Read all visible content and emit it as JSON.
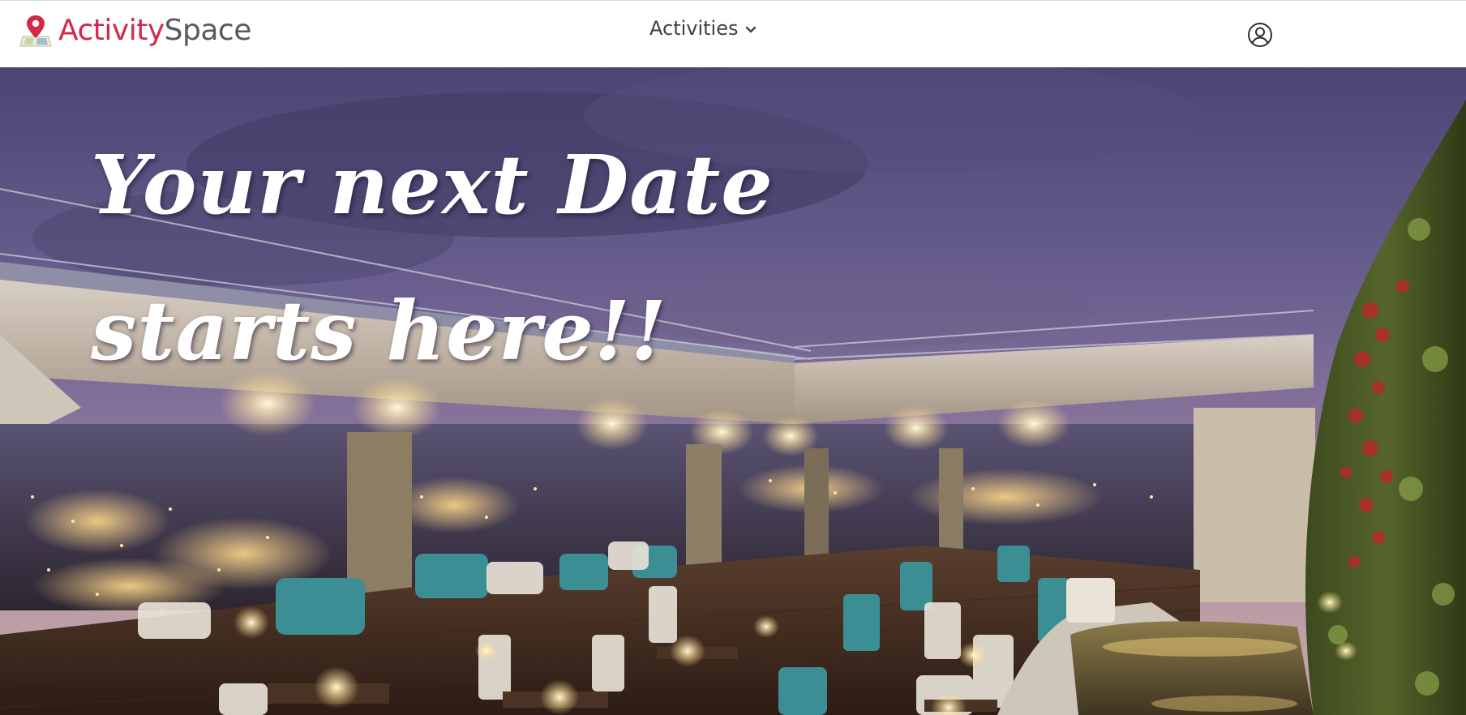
{
  "brand": {
    "name_part1": "Activity",
    "name_part2": "Space",
    "icon": "map-pin-icon",
    "colors": {
      "accent": "#d2284a",
      "secondary": "#555a60"
    }
  },
  "nav": {
    "dropdown_label": "Activities",
    "dropdown_icon": "chevron-down-icon",
    "user_icon": "user-circle-icon"
  },
  "hero": {
    "headline_line1": "Your next Date",
    "headline_line2": "starts here!!",
    "background": "rooftop-restaurant-at-dusk"
  }
}
